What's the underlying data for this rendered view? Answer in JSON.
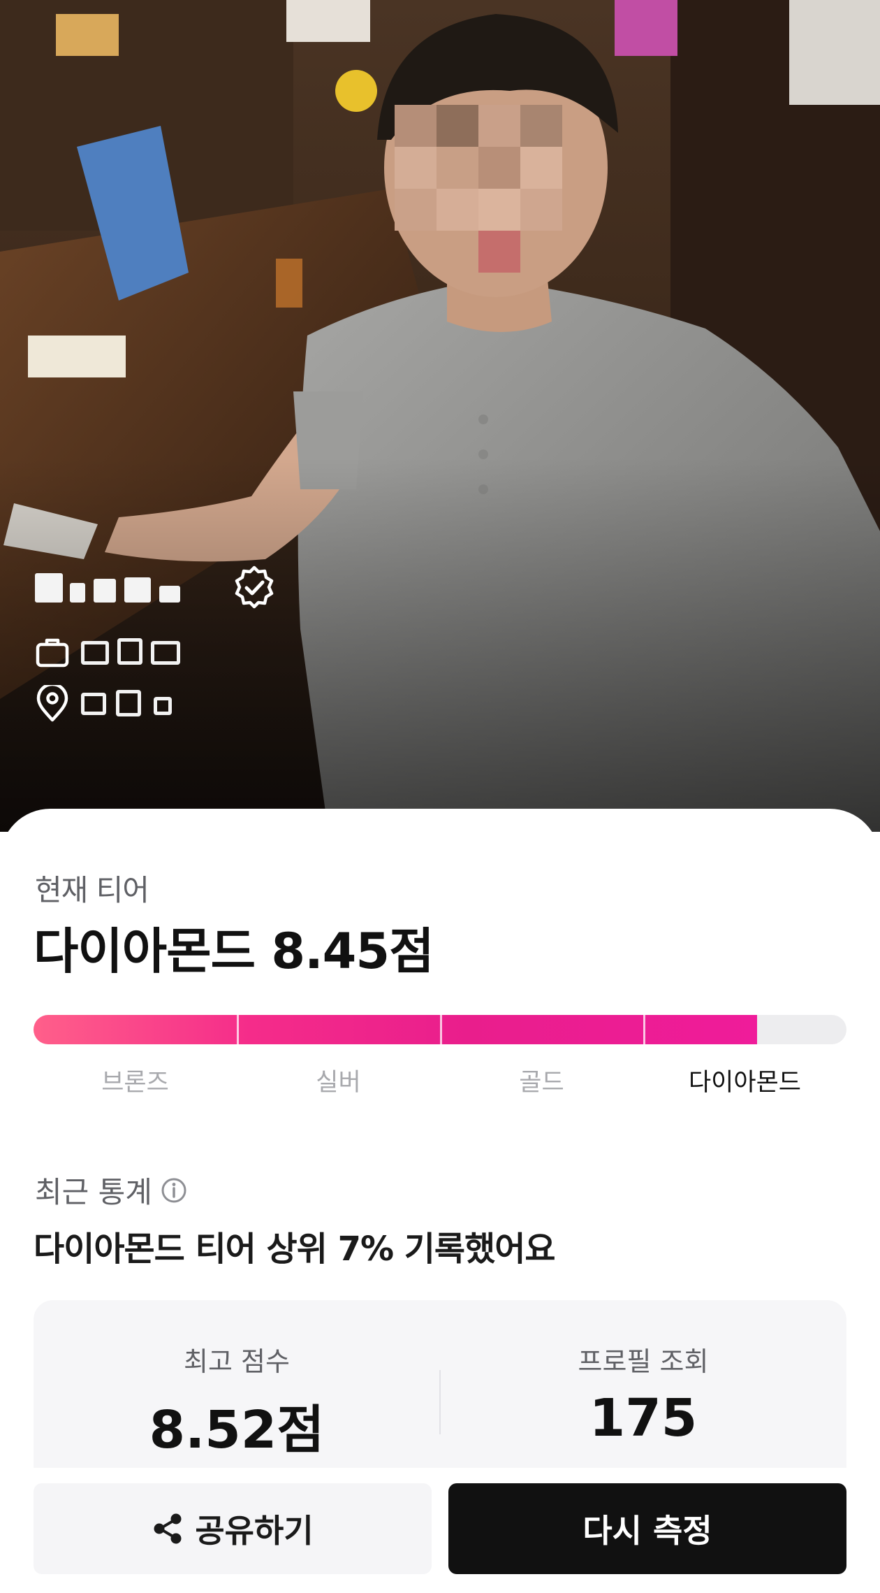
{
  "profile": {
    "photo_alt": "profile photo",
    "verified_icon": "verified-badge-icon",
    "job_icon": "briefcase-icon",
    "location_icon": "location-pin-icon"
  },
  "tier": {
    "caption": "현재 티어",
    "title": "다이아몬드 8.45점",
    "progress_fraction": 0.89,
    "levels": [
      "브론즈",
      "실버",
      "골드",
      "다이아몬드"
    ],
    "active_level": "다이아몬드"
  },
  "stats": {
    "caption": "최근 통계",
    "info_icon": "info-circle-icon",
    "description": "다이아몬드 티어 상위 7% 기록했어요",
    "best_score_label": "최고 점수",
    "best_score_value": "8.52점",
    "profile_views_label": "프로필 조회",
    "profile_views_value": "175"
  },
  "actions": {
    "share_icon": "share-icon",
    "share_label": "공유하기",
    "remeasure_label": "다시 측정"
  },
  "colors": {
    "accent": "#e91e8c",
    "accent_start": "#ff5f8a",
    "primary_button": "#111111",
    "bar_track": "#ededef"
  }
}
